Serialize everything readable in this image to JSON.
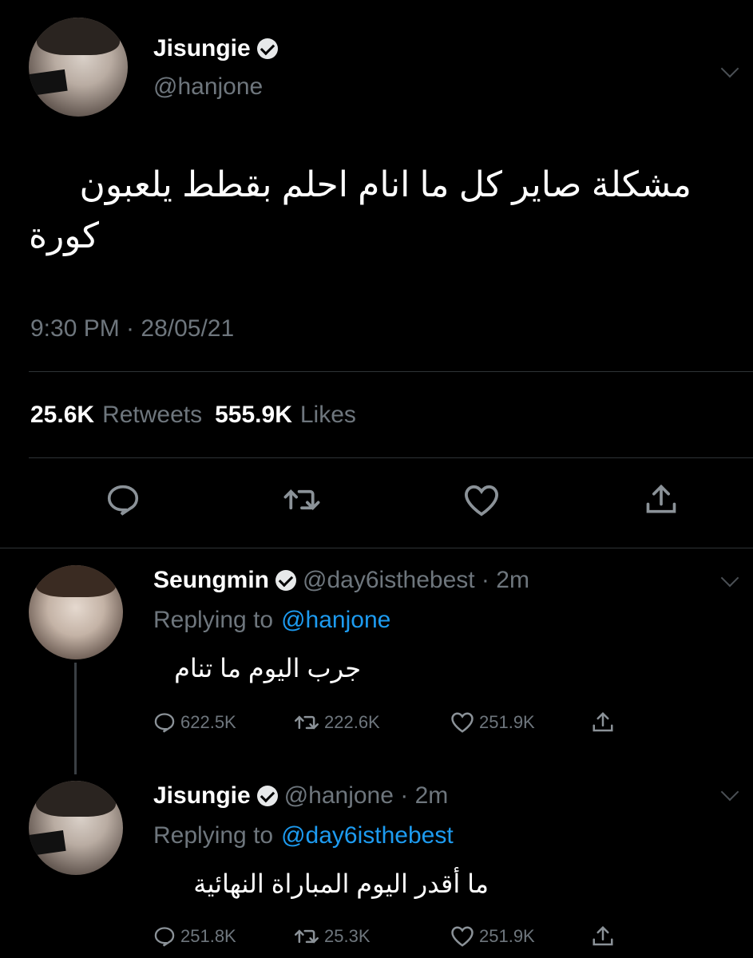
{
  "main_tweet": {
    "display_name": "Jisungie",
    "handle": "@hanjone",
    "text_line1": "مشكلة صاير كل ما انام احلم بقطط يلعبون",
    "text_line2": "كورة",
    "timestamp": "9:30 PM · 28/05/21",
    "retweets_count": "25.6K",
    "retweets_label": "Retweets",
    "likes_count": "555.9K",
    "likes_label": "Likes"
  },
  "reply1": {
    "display_name": "Seungmin",
    "handle_time": "@day6isthebest · 2m",
    "replying_prefix": "Replying to",
    "replying_to": "@hanjone",
    "text": "جرب اليوم ما تنام",
    "reply_count": "622.5K",
    "retweet_count": "222.6K",
    "like_count": "251.9K"
  },
  "reply2": {
    "display_name": "Jisungie",
    "handle_time": "@hanjone · 2m",
    "replying_prefix": "Replying to",
    "replying_to": "@day6isthebest",
    "text": "ما أقدر اليوم المباراة النهائية",
    "reply_count": "251.8K",
    "retweet_count": "25.3K",
    "like_count": "251.9K"
  },
  "icons": {
    "reply": "reply-icon",
    "retweet": "retweet-icon",
    "like": "heart-icon",
    "share": "share-icon",
    "verified": "verified-badge-icon",
    "more": "chevron-down-icon"
  },
  "colors": {
    "background": "#000000",
    "text": "#ffffff",
    "secondary": "#6e767d",
    "link": "#1d9bf0"
  }
}
